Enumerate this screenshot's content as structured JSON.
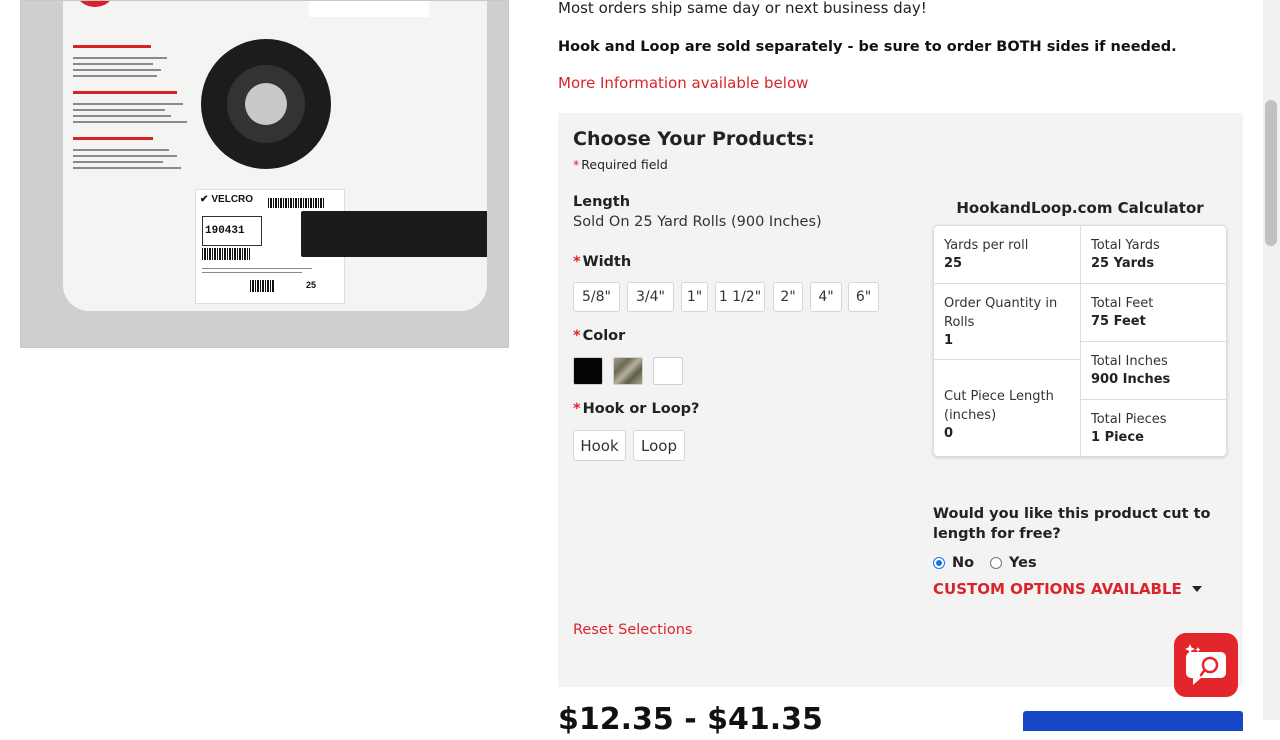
{
  "shipping": {
    "text": "Most orders ship same day or next business day!",
    "notice": "Hook and Loop are sold separately - be sure to order BOTH sides if needed.",
    "more_info_link": "More Information available below"
  },
  "product_image": {
    "brand": "VELCRO",
    "part_number": "190431",
    "count": "25"
  },
  "options": {
    "title": "Choose Your Products:",
    "required_star": "*",
    "required_note": "Required field",
    "length_label": "Length",
    "length_value": "Sold On 25 Yard Rolls (900 Inches)",
    "width_label": "Width",
    "widths": [
      "5/8\"",
      "3/4\"",
      "1\"",
      "1 1/2\"",
      "2\"",
      "4\"",
      "6\""
    ],
    "color_label": "Color",
    "colors": [
      "black",
      "camo",
      "white"
    ],
    "hook_loop_label": "Hook or Loop?",
    "hook_loop": [
      "Hook",
      "Loop"
    ],
    "reset": "Reset Selections"
  },
  "calculator": {
    "title": "HookandLoop.com Calculator",
    "left": [
      {
        "label": "Yards per roll",
        "value": "25"
      },
      {
        "label": "Order Quantity in Rolls",
        "value": "1"
      },
      {
        "label": "Cut Piece Length (inches)",
        "value": "0"
      }
    ],
    "right": [
      {
        "label": "Total Yards",
        "value": "25 Yards"
      },
      {
        "label": "Total Feet",
        "value": "75 Feet"
      },
      {
        "label": "Total Inches",
        "value": "900 Inches"
      },
      {
        "label": "Total Pieces",
        "value": "1 Piece"
      }
    ]
  },
  "cut": {
    "question": "Would you like this product cut to length for free?",
    "options": [
      {
        "label": "No",
        "checked": true
      },
      {
        "label": "Yes",
        "checked": false
      }
    ],
    "custom_options": "CUSTOM OPTIONS AVAILABLE"
  },
  "price": {
    "range": "$12.35 - $41.35"
  },
  "colors": {
    "accent_red": "#d9252a",
    "panel_bg": "#f3f3f3",
    "radio_blue": "#1a73e8",
    "cart_blue": "#1747c9"
  }
}
